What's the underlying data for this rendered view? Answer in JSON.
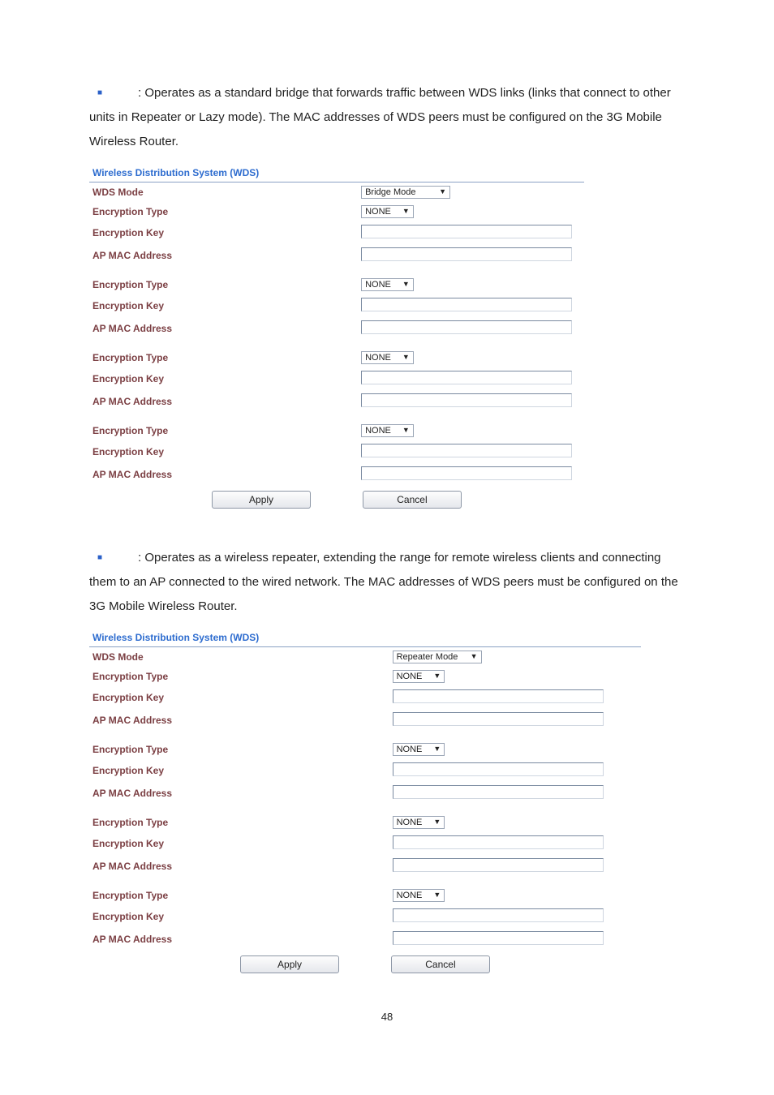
{
  "p1": ": Operates as a standard bridge that forwards traffic between WDS links (links that connect to other units in Repeater or Lazy mode). The MAC addresses of WDS peers must be configured on the 3G Mobile Wireless Router.",
  "p2": ": Operates as a wireless repeater, extending the range for remote wireless clients and connecting them to an AP connected to the wired network. The MAC addresses of WDS peers must be configured on the 3G Mobile Wireless Router.",
  "labels": {
    "panelTitle": "Wireless Distribution System (WDS)",
    "wdsMode": "WDS Mode",
    "encType": "Encryption Type",
    "encKey": "Encryption Key",
    "apMac": "AP MAC Address"
  },
  "selects": {
    "bridge": "Bridge Mode",
    "repeater": "Repeater Mode",
    "none": "NONE"
  },
  "buttons": {
    "apply": "Apply",
    "cancel": "Cancel"
  },
  "pageNumber": "48"
}
